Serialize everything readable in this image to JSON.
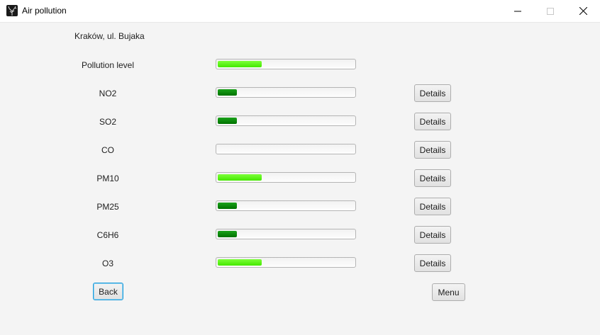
{
  "window": {
    "title": "Air pollution"
  },
  "location": "Kraków, ul. Bujaka",
  "pollution_level": {
    "label": "Pollution level",
    "level": 0.32,
    "color": "#44e800"
  },
  "rows": [
    {
      "label": "NO2",
      "level": 0.14,
      "color": "#007200",
      "details_label": "Details"
    },
    {
      "label": "SO2",
      "level": 0.14,
      "color": "#007200",
      "details_label": "Details"
    },
    {
      "label": "CO",
      "level": 0.0,
      "color": "#007200",
      "details_label": "Details"
    },
    {
      "label": "PM10",
      "level": 0.32,
      "color": "#44e800",
      "details_label": "Details"
    },
    {
      "label": "PM25",
      "level": 0.14,
      "color": "#007200",
      "details_label": "Details"
    },
    {
      "label": "C6H6",
      "level": 0.14,
      "color": "#007200",
      "details_label": "Details"
    },
    {
      "label": "O3",
      "level": 0.32,
      "color": "#44e800",
      "details_label": "Details"
    }
  ],
  "buttons": {
    "back": "Back",
    "menu": "Menu"
  }
}
